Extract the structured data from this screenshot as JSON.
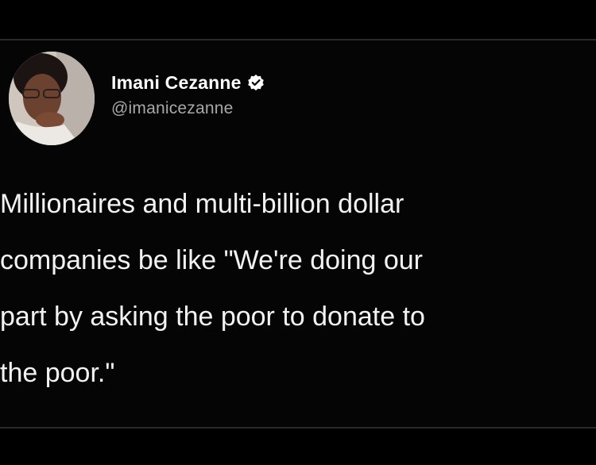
{
  "tweet": {
    "author": {
      "display_name": "Imani Cezanne",
      "handle": "@imanicezanne",
      "verified_icon": "verified-badge-icon",
      "avatar": "profile-photo"
    },
    "text": "Millionaires and multi-billion dollar\ncompanies be like \"We're doing our\npart by asking the poor to donate to\nthe poor.\""
  },
  "colors": {
    "background": "#000000",
    "name": "#ffffff",
    "handle": "#a8a8a8",
    "body_text": "#f2f2f2",
    "badge": "#ffffff"
  }
}
